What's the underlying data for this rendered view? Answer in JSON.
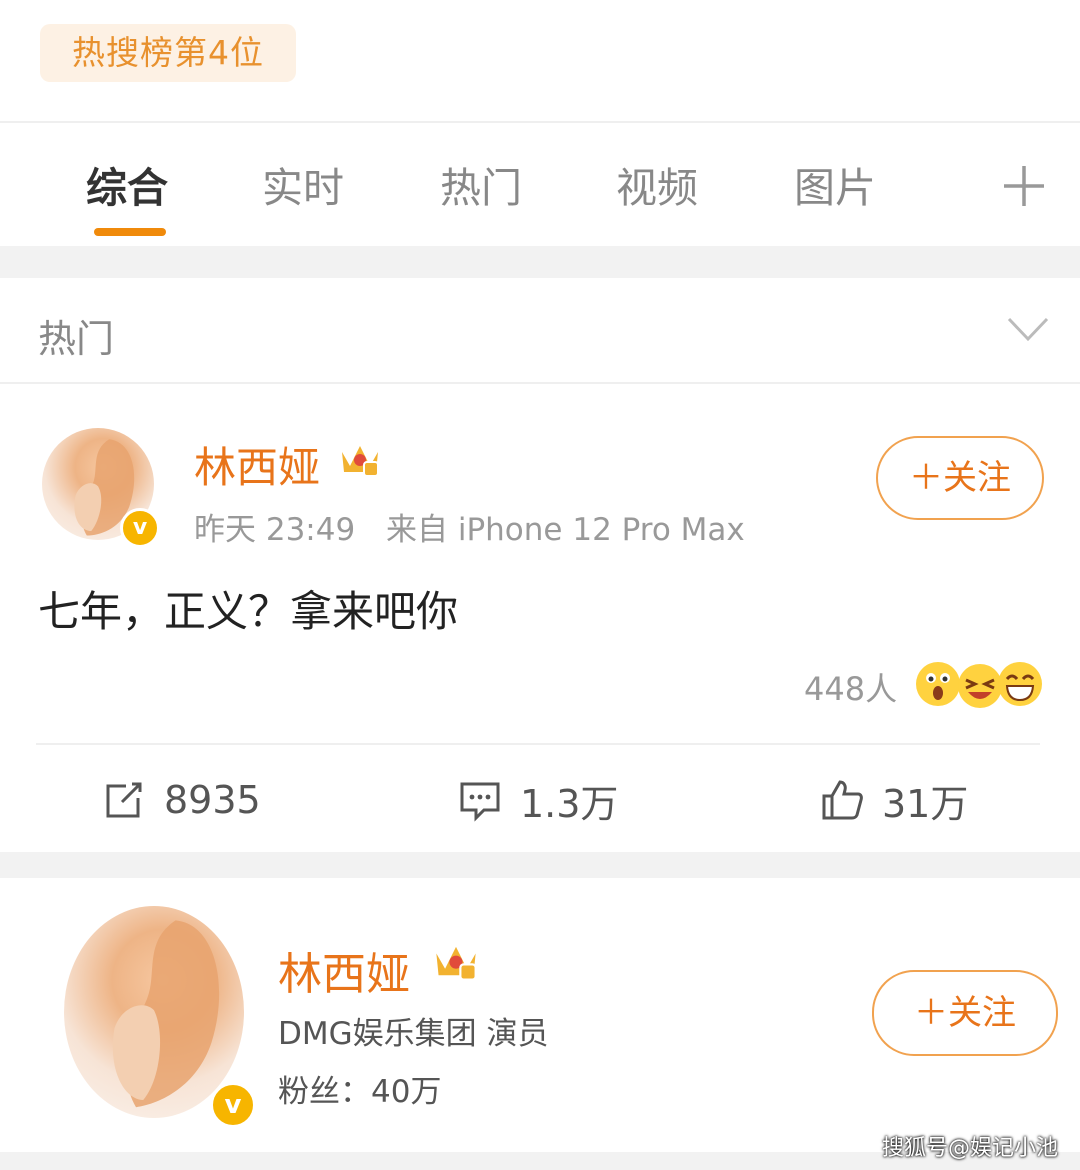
{
  "hot_badge": "热搜榜第4位",
  "tabs": [
    {
      "label": "综合",
      "active": true
    },
    {
      "label": "实时",
      "active": false
    },
    {
      "label": "热门",
      "active": false
    },
    {
      "label": "视频",
      "active": false
    },
    {
      "label": "图片",
      "active": false
    }
  ],
  "section": {
    "title": "热门"
  },
  "post": {
    "username": "林西娅",
    "time": "昨天 23:49",
    "source": "来自 iPhone 12 Pro Max",
    "follow_label": "＋关注",
    "text": "七年，正义？拿来吧你",
    "reaction_count": "448人",
    "reaction_icons": [
      "shocked-face-icon",
      "laughing-face-icon",
      "grinning-face-icon"
    ],
    "actions": {
      "repost": "8935",
      "comment": "1.3万",
      "like": "31万"
    }
  },
  "profile": {
    "username": "林西娅",
    "description": "DMG娱乐集团 演员",
    "fans": "粉丝：40万",
    "follow_label": "＋关注"
  },
  "watermark": "搜狐号@娱记小池",
  "colors": {
    "accent": "#f08a0b",
    "username": "#e8741a",
    "verified": "#f7b500"
  }
}
